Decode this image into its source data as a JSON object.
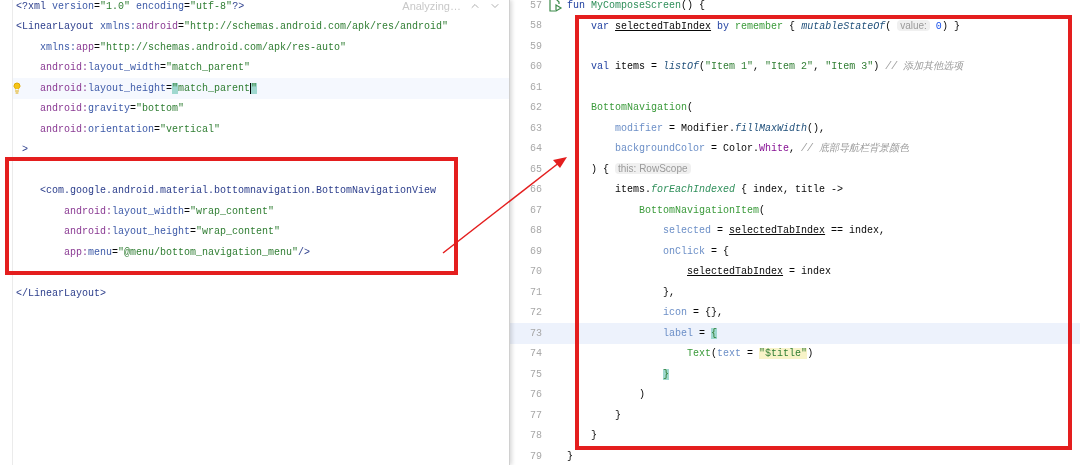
{
  "xml_editor": {
    "status": "Analyzing…",
    "lines": [
      {
        "kind": "code",
        "tokens": [
          {
            "text": "<?xml ",
            "kind": "tag"
          },
          {
            "text": "version",
            "kind": "attr"
          },
          {
            "text": "=",
            "kind": "plain"
          },
          {
            "text": "\"1.0\"",
            "kind": "str"
          },
          {
            "text": " encoding",
            "kind": "attr"
          },
          {
            "text": "=",
            "kind": "plain"
          },
          {
            "text": "\"utf-8\"",
            "kind": "str"
          },
          {
            "text": "?>",
            "kind": "tag"
          }
        ]
      },
      {
        "kind": "code",
        "tokens": [
          {
            "text": "<LinearLayout",
            "kind": "tag"
          },
          {
            "text": " xmlns:",
            "kind": "attr"
          },
          {
            "text": "android",
            "kind": "ns"
          },
          {
            "text": "=",
            "kind": "plain"
          },
          {
            "text": "\"http://schemas.android.com/apk/res/android\"",
            "kind": "str"
          }
        ]
      },
      {
        "kind": "code",
        "tokens": [
          {
            "text": "    xmlns:",
            "kind": "attr"
          },
          {
            "text": "app",
            "kind": "ns"
          },
          {
            "text": "=",
            "kind": "plain"
          },
          {
            "text": "\"http://schemas.android.com/apk/res-auto\"",
            "kind": "str"
          }
        ]
      },
      {
        "kind": "code",
        "tokens": [
          {
            "text": "    android:",
            "kind": "ns"
          },
          {
            "text": "layout_width",
            "kind": "attr"
          },
          {
            "text": "=",
            "kind": "plain"
          },
          {
            "text": "\"match_parent\"",
            "kind": "str"
          }
        ]
      },
      {
        "kind": "code",
        "bulb": true,
        "current": true,
        "tokens": [
          {
            "text": "    android:",
            "kind": "ns"
          },
          {
            "text": "layout_height",
            "kind": "attr"
          },
          {
            "text": "=",
            "kind": "plain"
          },
          {
            "text": "\"",
            "kind": "match"
          },
          {
            "text": "match_parent",
            "kind": "str"
          },
          {
            "text": "\"",
            "kind": "match",
            "caret": true
          }
        ]
      },
      {
        "kind": "code",
        "tokens": [
          {
            "text": "    android:",
            "kind": "ns"
          },
          {
            "text": "gravity",
            "kind": "attr"
          },
          {
            "text": "=",
            "kind": "plain"
          },
          {
            "text": "\"bottom\"",
            "kind": "str"
          }
        ]
      },
      {
        "kind": "code",
        "tokens": [
          {
            "text": "    android:",
            "kind": "ns"
          },
          {
            "text": "orientation",
            "kind": "attr"
          },
          {
            "text": "=",
            "kind": "plain"
          },
          {
            "text": "\"vertical\"",
            "kind": "str"
          }
        ]
      },
      {
        "kind": "code",
        "tokens": [
          {
            "text": " >",
            "kind": "tag"
          }
        ]
      },
      {
        "kind": "blank"
      },
      {
        "kind": "code",
        "tokens": [
          {
            "text": "    <com.google.android.material.bottomnavigation.BottomNavigationView",
            "kind": "tag"
          }
        ]
      },
      {
        "kind": "code",
        "tokens": [
          {
            "text": "        android:",
            "kind": "ns"
          },
          {
            "text": "layout_width",
            "kind": "attr"
          },
          {
            "text": "=",
            "kind": "plain"
          },
          {
            "text": "\"wrap_content\"",
            "kind": "str"
          }
        ]
      },
      {
        "kind": "code",
        "tokens": [
          {
            "text": "        android:",
            "kind": "ns"
          },
          {
            "text": "layout_height",
            "kind": "attr"
          },
          {
            "text": "=",
            "kind": "plain"
          },
          {
            "text": "\"wrap_content\"",
            "kind": "str"
          }
        ]
      },
      {
        "kind": "code",
        "tokens": [
          {
            "text": "        app:",
            "kind": "ns"
          },
          {
            "text": "menu",
            "kind": "attr"
          },
          {
            "text": "=",
            "kind": "plain"
          },
          {
            "text": "\"@menu/bottom_navigation_menu\"",
            "kind": "str"
          },
          {
            "text": "/>",
            "kind": "tag"
          }
        ]
      },
      {
        "kind": "blank"
      },
      {
        "kind": "code",
        "tokens": [
          {
            "text": "</LinearLayout>",
            "kind": "tag"
          }
        ]
      }
    ]
  },
  "kotlin_editor": {
    "lines": [
      {
        "number": "57",
        "run": true,
        "tokens": [
          {
            "text": "fun ",
            "kind": "kw"
          },
          {
            "text": "MyComposeScreen",
            "kind": "decl"
          },
          {
            "text": "() {",
            "kind": "plain"
          }
        ]
      },
      {
        "number": "58",
        "tokens": [
          {
            "text": "    var ",
            "kind": "kw"
          },
          {
            "text": "selectedTabIndex",
            "kind": "var"
          },
          {
            "text": " by ",
            "kind": "kw"
          },
          {
            "text": "remember",
            "kind": "comp"
          },
          {
            "text": " { ",
            "kind": "plain"
          },
          {
            "text": "mutableStateOf",
            "kind": "ital"
          },
          {
            "text": "( ",
            "kind": "plain"
          },
          {
            "text": "value:",
            "kind": "hint"
          },
          {
            "text": " 0",
            "kind": "num"
          },
          {
            "text": ") }",
            "kind": "plain"
          }
        ]
      },
      {
        "number": "59"
      },
      {
        "number": "60",
        "tokens": [
          {
            "text": "    val ",
            "kind": "kw"
          },
          {
            "text": "items = ",
            "kind": "plain"
          },
          {
            "text": "listOf",
            "kind": "ital"
          },
          {
            "text": "(",
            "kind": "plain"
          },
          {
            "text": "\"Item 1\"",
            "kind": "str"
          },
          {
            "text": ", ",
            "kind": "plain"
          },
          {
            "text": "\"Item 2\"",
            "kind": "str"
          },
          {
            "text": ", ",
            "kind": "plain"
          },
          {
            "text": "\"Item 3\"",
            "kind": "str"
          },
          {
            "text": ") ",
            "kind": "plain"
          },
          {
            "text": "// 添加其他选项",
            "kind": "comment"
          }
        ]
      },
      {
        "number": "61"
      },
      {
        "number": "62",
        "tokens": [
          {
            "text": "    BottomNavigation",
            "kind": "comp"
          },
          {
            "text": "(",
            "kind": "plain"
          }
        ]
      },
      {
        "number": "63",
        "tokens": [
          {
            "text": "        modifier",
            "kind": "param"
          },
          {
            "text": " = Modifier.",
            "kind": "plain"
          },
          {
            "text": "fillMaxWidth",
            "kind": "ital"
          },
          {
            "text": "(),",
            "kind": "plain"
          }
        ]
      },
      {
        "number": "64",
        "tokens": [
          {
            "text": "        backgroundColor",
            "kind": "param"
          },
          {
            "text": " = Color.",
            "kind": "plain"
          },
          {
            "text": "White",
            "kind": "const"
          },
          {
            "text": ", ",
            "kind": "plain"
          },
          {
            "text": "// 底部导航栏背景颜色",
            "kind": "comment"
          }
        ]
      },
      {
        "number": "65",
        "tokens": [
          {
            "text": "    ) { ",
            "kind": "plain"
          },
          {
            "text": "this: RowScope",
            "kind": "hint"
          }
        ]
      },
      {
        "number": "66",
        "tokens": [
          {
            "text": "        items.",
            "kind": "plain"
          },
          {
            "text": "forEachIndexed",
            "kind": "italgreen"
          },
          {
            "text": " { index, title ->",
            "kind": "plain"
          }
        ]
      },
      {
        "number": "67",
        "tokens": [
          {
            "text": "            BottomNavigationItem",
            "kind": "comp"
          },
          {
            "text": "(",
            "kind": "plain"
          }
        ]
      },
      {
        "number": "68",
        "tokens": [
          {
            "text": "                selected",
            "kind": "param"
          },
          {
            "text": " = ",
            "kind": "plain"
          },
          {
            "text": "selectedTabIndex",
            "kind": "var"
          },
          {
            "text": " == index,",
            "kind": "plain"
          }
        ]
      },
      {
        "number": "69",
        "tokens": [
          {
            "text": "                onClick",
            "kind": "param"
          },
          {
            "text": " = {",
            "kind": "plain"
          }
        ]
      },
      {
        "number": "70",
        "tokens": [
          {
            "text": "                    selectedTabIndex",
            "kind": "var"
          },
          {
            "text": " = index",
            "kind": "plain"
          }
        ]
      },
      {
        "number": "71",
        "tokens": [
          {
            "text": "                },",
            "kind": "plain"
          }
        ]
      },
      {
        "number": "72",
        "tokens": [
          {
            "text": "                icon",
            "kind": "param"
          },
          {
            "text": " = {},",
            "kind": "plain"
          }
        ]
      },
      {
        "number": "73",
        "current": true,
        "tokens": [
          {
            "text": "                label",
            "kind": "param"
          },
          {
            "text": " = ",
            "kind": "plain"
          },
          {
            "text": "{",
            "kind": "match"
          }
        ]
      },
      {
        "number": "74",
        "tokens": [
          {
            "text": "                    Text",
            "kind": "comp"
          },
          {
            "text": "(",
            "kind": "plain"
          },
          {
            "text": "text",
            "kind": "param"
          },
          {
            "text": " = ",
            "kind": "plain"
          },
          {
            "text": "\"$title\"",
            "kind": "strhl"
          },
          {
            "text": ")",
            "kind": "plain"
          }
        ]
      },
      {
        "number": "75",
        "tokens": [
          {
            "text": "                }",
            "kind": "match"
          }
        ]
      },
      {
        "number": "76",
        "tokens": [
          {
            "text": "            )",
            "kind": "plain"
          }
        ]
      },
      {
        "number": "77",
        "tokens": [
          {
            "text": "        }",
            "kind": "plain"
          }
        ]
      },
      {
        "number": "78",
        "tokens": [
          {
            "text": "    }",
            "kind": "plain"
          }
        ]
      },
      {
        "number": "79",
        "tokens": [
          {
            "text": "}",
            "kind": "plain"
          }
        ]
      }
    ]
  }
}
